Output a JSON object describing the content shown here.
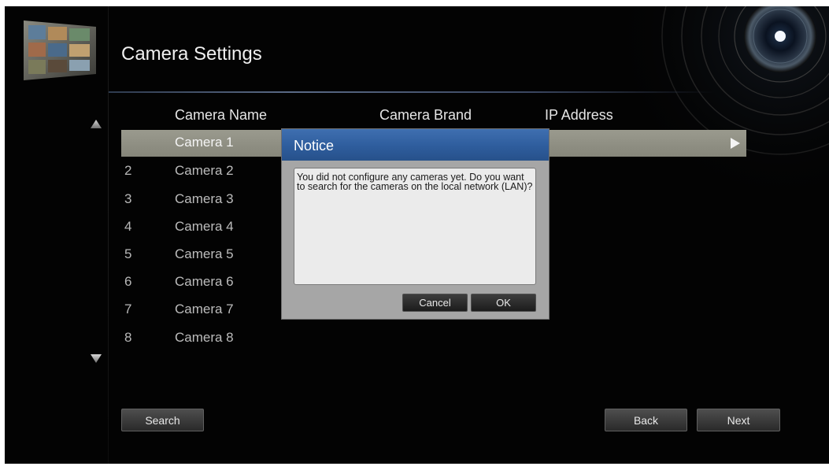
{
  "page": {
    "title": "Camera Settings"
  },
  "table": {
    "headers": {
      "name": "Camera Name",
      "brand": "Camera Brand",
      "ip": "IP Address"
    },
    "rows": [
      {
        "num": "",
        "name": "Camera 1",
        "selected": true
      },
      {
        "num": "2",
        "name": "Camera 2"
      },
      {
        "num": "3",
        "name": "Camera 3"
      },
      {
        "num": "4",
        "name": "Camera 4"
      },
      {
        "num": "5",
        "name": "Camera 5"
      },
      {
        "num": "6",
        "name": "Camera 6"
      },
      {
        "num": "7",
        "name": "Camera 7"
      },
      {
        "num": "8",
        "name": "Camera 8"
      }
    ]
  },
  "buttons": {
    "search": "Search",
    "back": "Back",
    "next": "Next"
  },
  "dialog": {
    "title": "Notice",
    "message": "You did not configure any cameras yet. Do you want to search for the cameras on the local network (LAN)?",
    "cancel": "Cancel",
    "ok": "OK"
  },
  "icons": {
    "scroll_up": "triangle-up-icon",
    "scroll_down": "triangle-down-icon",
    "row_action": "play-arrow-icon",
    "logo": "surveillance-monitors-logo",
    "decoration": "camera-lens-graphic"
  },
  "colors": {
    "background": "#030303",
    "selected_row": "#8e8e82",
    "dialog_header": "#2e5d9d",
    "dialog_frame": "#a6a6a6"
  }
}
